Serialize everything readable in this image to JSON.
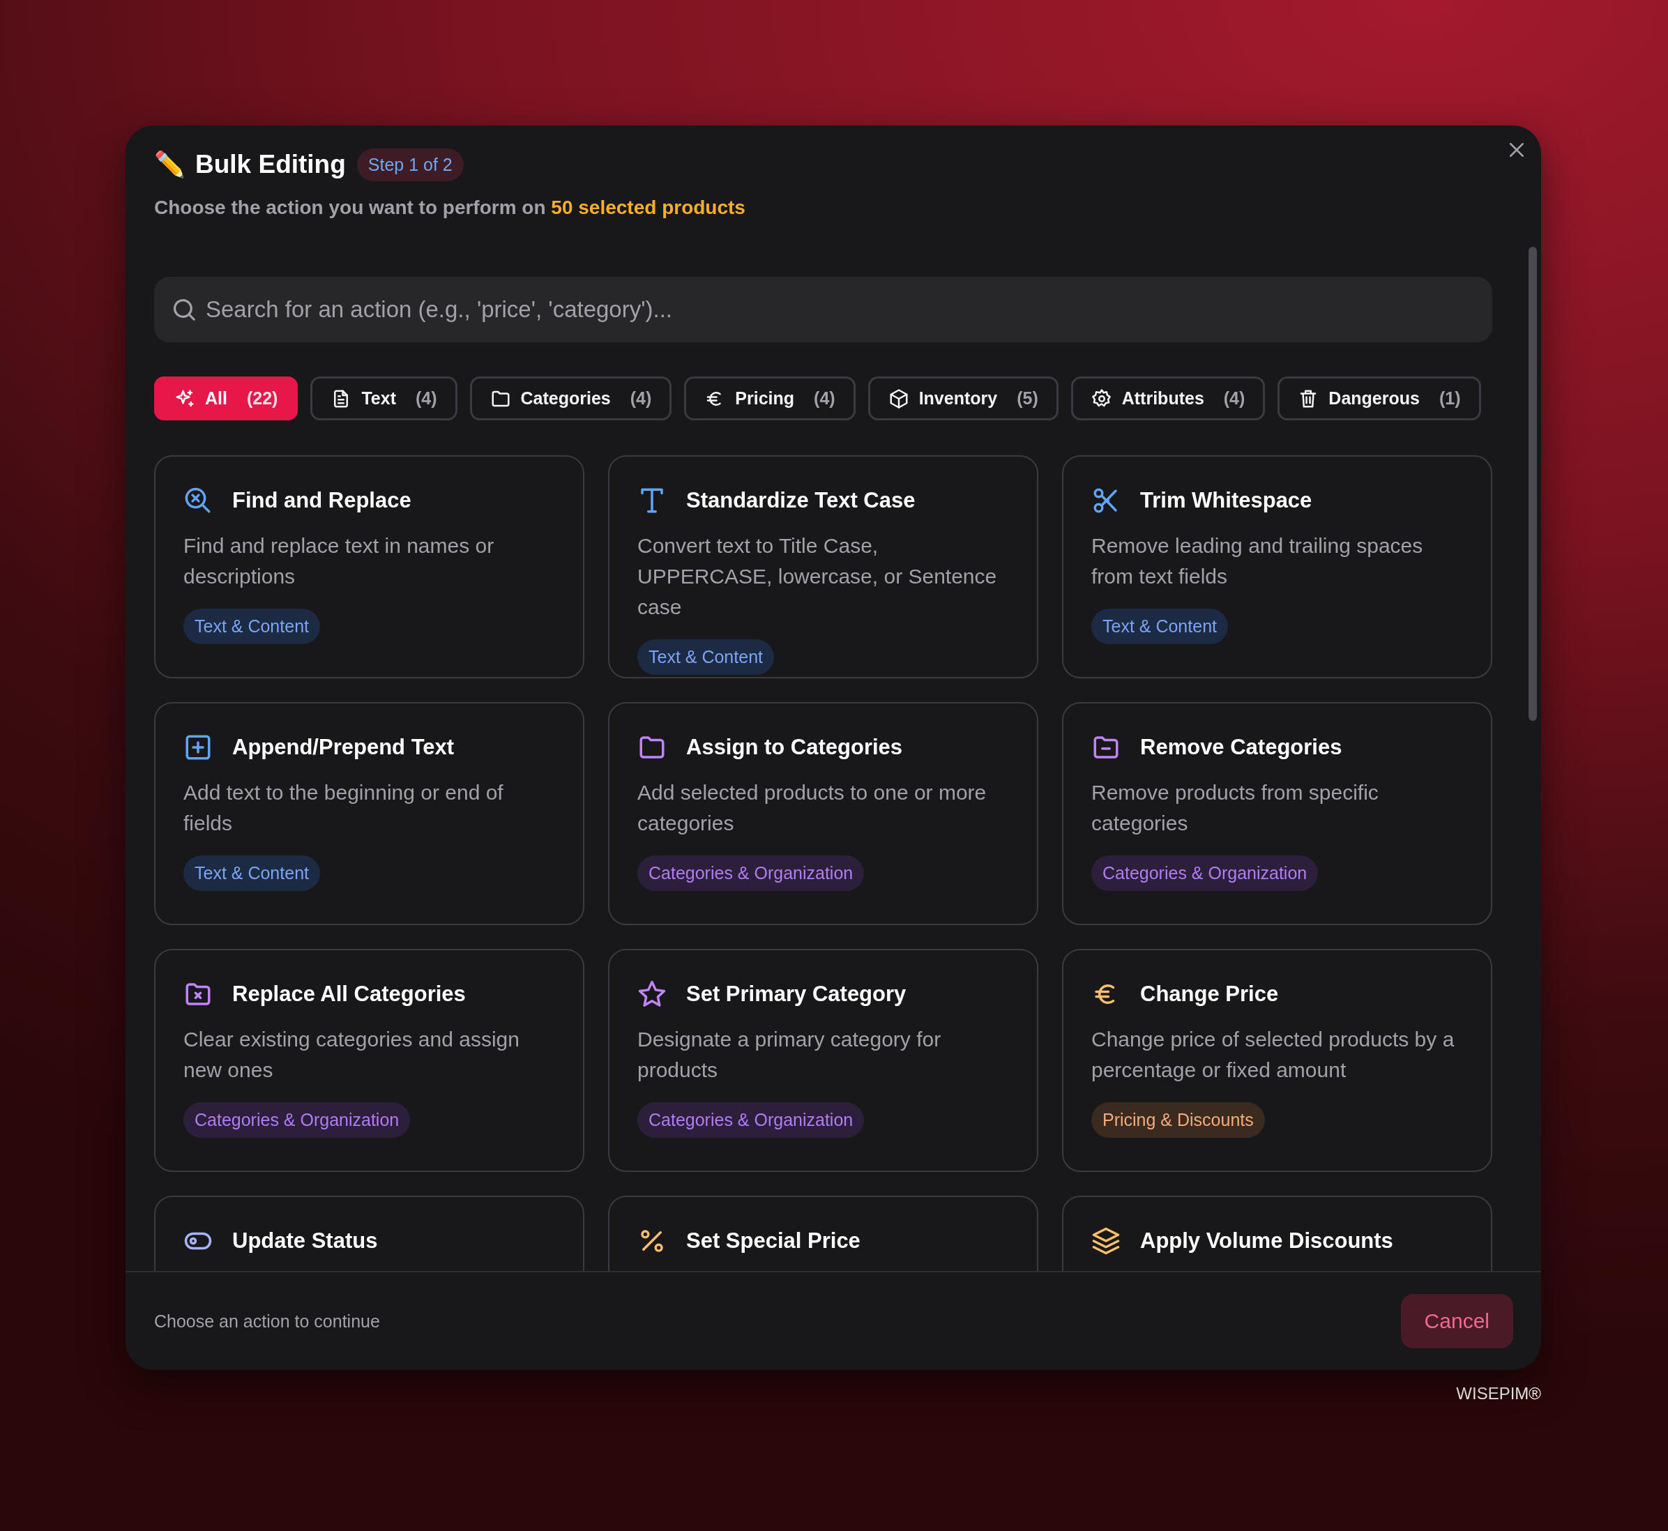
{
  "dialog": {
    "title_icon": "✏️",
    "title": "Bulk Editing",
    "step": "Step 1 of 2",
    "subtitle": "Choose the action you want to perform on **50 selected products**"
  },
  "search": {
    "placeholder": "Search for an action (e.g., 'price', 'category')..."
  },
  "filters": [
    {
      "label": "All",
      "count": "(22)",
      "selected": true
    },
    {
      "label": "Text",
      "count": "(4)",
      "selected": false
    },
    {
      "label": "Categories",
      "count": "(4)",
      "selected": false
    },
    {
      "label": "Pricing",
      "count": "(4)",
      "selected": false
    },
    {
      "label": "Inventory",
      "count": "(5)",
      "selected": false
    },
    {
      "label": "Attributes",
      "count": "(4)",
      "selected": false
    },
    {
      "label": "Dangerous",
      "count": "(1)",
      "selected": false
    }
  ],
  "actions": [
    {
      "title": "Find and Replace",
      "description": "Find and replace text in names or descriptions",
      "tag": {
        "label": "Text & Content",
        "color": "#1c2a44"
      }
    },
    {
      "title": "Standardize Text Case",
      "description": "Convert text to Title Case, UPPERCASE, lowercase, or Sentence case",
      "tag": {
        "label": "Text & Content",
        "color": "#1c2a44"
      }
    },
    {
      "title": "Trim Whitespace",
      "description": "Remove leading and trailing spaces from text fields",
      "tag": {
        "label": "Text & Content",
        "color": "#1c2a44"
      }
    },
    {
      "title": "Append/Prepend Text",
      "description": "Add text to the beginning or end of fields",
      "tag": {
        "label": "Text & Content",
        "color": "#1c2a44"
      }
    },
    {
      "title": "Assign to Categories",
      "description": "Add selected products to one or more categories",
      "tag": {
        "label": "Categories & Organization",
        "color": "#2c1f3c"
      }
    },
    {
      "title": "Remove Categories",
      "description": "Remove products from specific categories",
      "tag": {
        "label": "Categories & Organization",
        "color": "#2c1f3c"
      }
    },
    {
      "title": "Replace All Categories",
      "description": "Clear existing categories and assign new ones",
      "tag": {
        "label": "Categories & Organization",
        "color": "#2c1f3c"
      }
    },
    {
      "title": "Set Primary Category",
      "description": "Designate a primary category for products",
      "tag": {
        "label": "Categories & Organization",
        "color": "#2c1f3c"
      }
    },
    {
      "title": "Change Price",
      "description": "Change price of selected products by a percentage or fixed amount",
      "tag": {
        "label": "Pricing & Discounts",
        "color": "#3a2a1f"
      }
    },
    {
      "title": "Update Status"
    },
    {
      "title": "Set Special Price"
    },
    {
      "title": "Apply Volume Discounts"
    }
  ],
  "footer": {
    "hint": "Choose an action to continue",
    "cancel": "Cancel"
  },
  "brand": "WISEPIM®"
}
